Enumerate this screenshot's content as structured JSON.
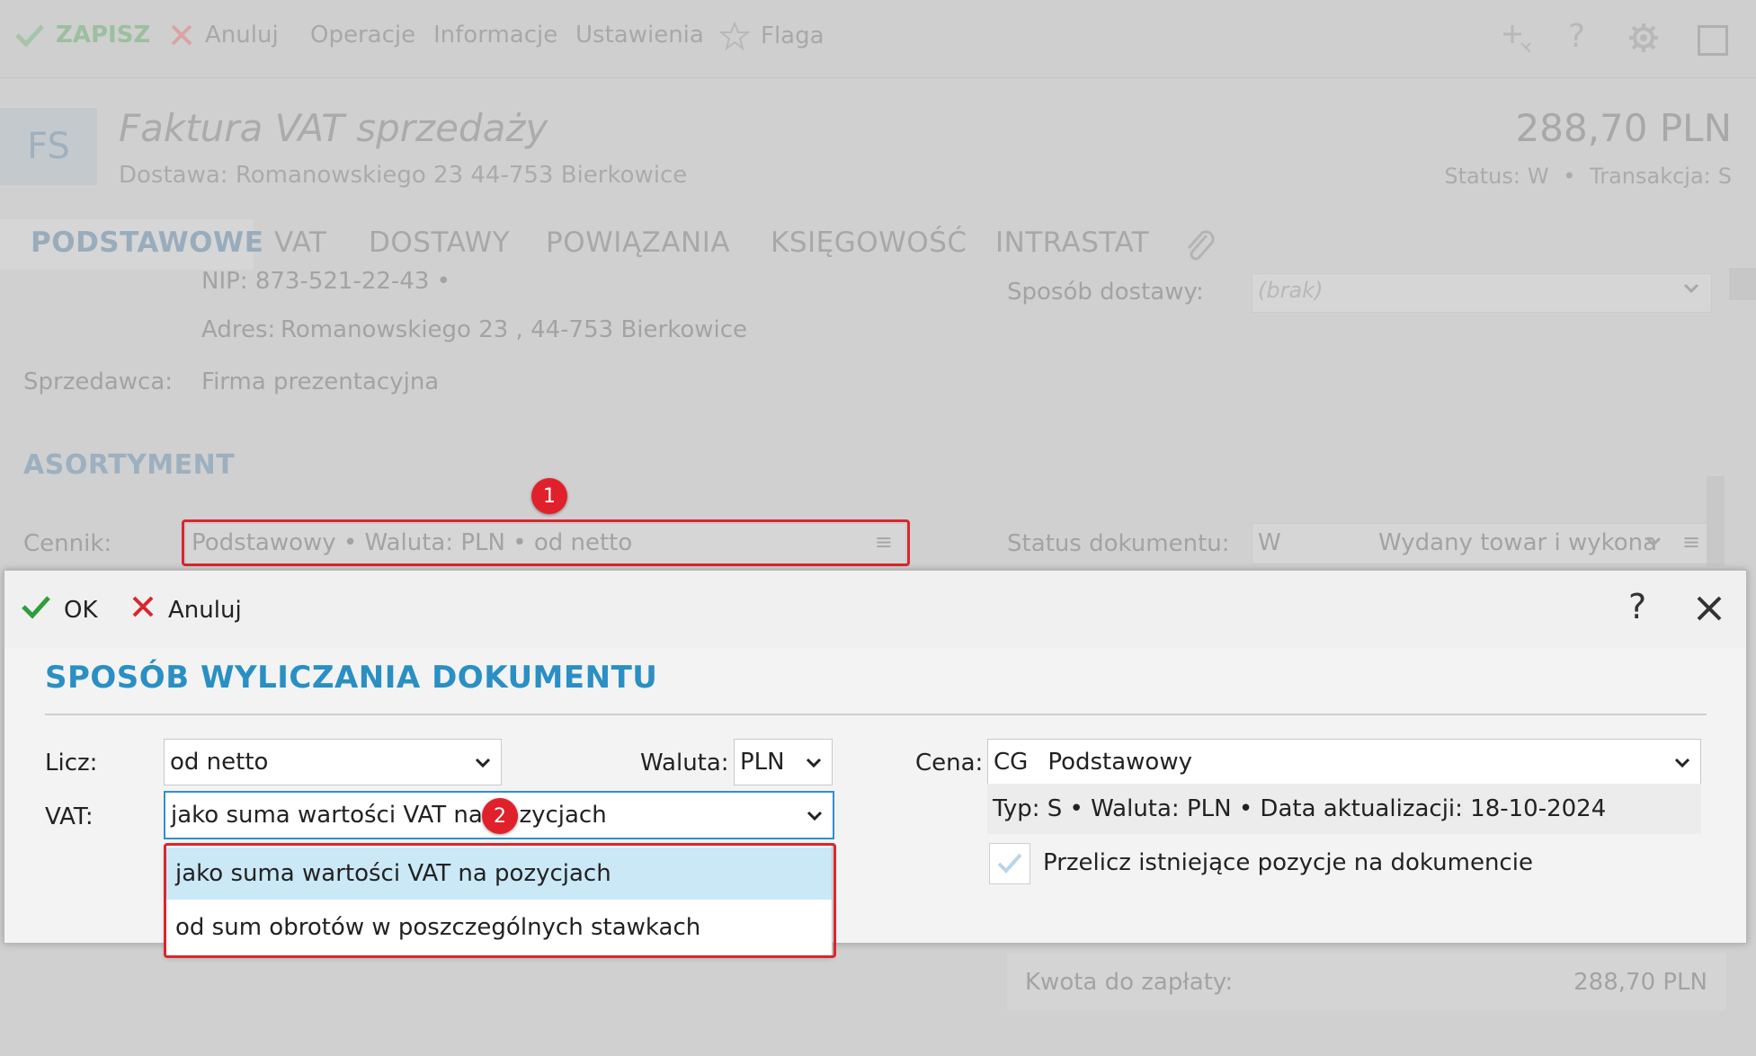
{
  "toolbar": {
    "save": "ZAPISZ",
    "cancel": "Anuluj",
    "operations": "Operacje",
    "information": "Informacje",
    "settings": "Ustawienia",
    "flag": "Flaga"
  },
  "header": {
    "doc_code": "FS",
    "doc_title": "Faktura VAT sprzedaży",
    "delivery": "Dostawa: Romanowskiego 23  44-753 Bierkowice",
    "amount": "288,70 PLN",
    "status_label": "Status:",
    "status_value": "W",
    "transaction_label": "Transakcja:",
    "transaction_value": "S"
  },
  "tabs": [
    "PODSTAWOWE",
    "VAT",
    "DOSTAWY",
    "POWIĄZANIA",
    "KSIĘGOWOŚĆ",
    "INTRASTAT"
  ],
  "form": {
    "nip": "NIP:  873-521-22-43  •",
    "address_label": "Adres:",
    "address_value": "Romanowskiego 23 , 44-753 Bierkowice",
    "seller_label": "Sprzedawca:",
    "seller_value": "Firma prezentacyjna",
    "delivery_method_label": "Sposób dostawy:",
    "delivery_method_value": "(brak)",
    "section_title": "ASORTYMENT",
    "pricelist_label": "Cennik:",
    "pricelist_value": "Podstawowy • Waluta: PLN • od netto",
    "doc_status_label": "Status dokumentu:",
    "doc_status_code": "W",
    "doc_status_value": "Wydany towar i wykona",
    "to_pay_label": "Kwota do zapłaty:",
    "to_pay_value": "288,70 PLN"
  },
  "markers": {
    "m1": "1",
    "m2": "2"
  },
  "dialog": {
    "ok": "OK",
    "cancel": "Anuluj",
    "help": "?",
    "title": "SPOSÓB WYLICZANIA DOKUMENTU",
    "count_label": "Licz:",
    "count_value": "od netto",
    "currency_label": "Waluta:",
    "currency_value": "PLN",
    "price_label": "Cena:",
    "price_code": "CG",
    "price_value": "Podstawowy",
    "vat_label": "VAT:",
    "vat_value": "jako suma wartości VAT na pozycjach",
    "price_info": "Typ: S • Waluta: PLN • Data aktualizacji: 18-10-2024",
    "recalc_label": "Przelicz istniejące pozycje na dokumencie",
    "vat_options": [
      "jako suma wartości VAT na pozycjach",
      "od sum obrotów w poszczególnych stawkach"
    ]
  },
  "colors": {
    "accent": "#2a8fc3",
    "marker": "#e0212b",
    "ok_green": "#2e9e3a",
    "cancel_red": "#d9262f",
    "selected_option": "#cbe8f6"
  }
}
